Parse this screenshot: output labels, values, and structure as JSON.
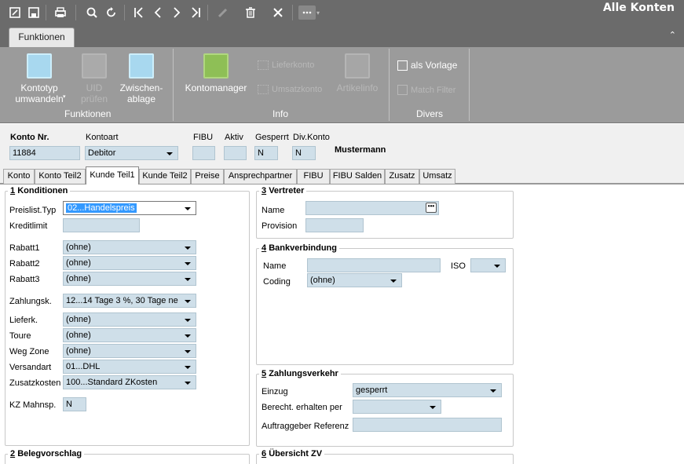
{
  "app": {
    "title": "Alle Konten"
  },
  "toolbar": {
    "icons": [
      "new-icon",
      "save-icon",
      "print-icon",
      "search-icon",
      "refresh-icon",
      "first-icon",
      "prev-icon",
      "next-icon",
      "last-icon",
      "edit-icon",
      "delete-icon",
      "close-icon",
      "more-icon"
    ]
  },
  "ribbon": {
    "tab_label": "Funktionen",
    "groups": {
      "funktionen": {
        "label": "Funktionen",
        "kontotyp": "Kontotyp\numwandeln",
        "uid": "UID\nprüfen",
        "zwischenablage": "Zwischen-\nablage"
      },
      "info": {
        "label": "Info",
        "kontomanager": "Kontomanager",
        "lieferkonto": "Lieferkonto",
        "umsatzkonto": "Umsatzkonto",
        "artikelinfo": "Artikelinfo"
      },
      "divers": {
        "label": "Divers",
        "als_vorlage": "als Vorlage",
        "match_filter": "Match Filter"
      }
    }
  },
  "header": {
    "konto_nr_label": "Konto Nr.",
    "konto_nr": "11884",
    "kontoart_label": "Kontoart",
    "kontoart": "Debitor",
    "fibu_label": "FIBU",
    "fibu": "",
    "aktiv_label": "Aktiv",
    "aktiv": "",
    "gesperrt_label": "Gesperrt",
    "gesperrt": "N",
    "divkonto_label": "Div.Konto",
    "divkonto": "N",
    "name": "Mustermann"
  },
  "tabs": [
    "Konto",
    "Konto Teil2",
    "Kunde Teil1",
    "Kunde Teil2",
    "Preise",
    "Ansprechpartner",
    "FIBU",
    "FIBU Salden",
    "Zusatz",
    "Umsatz"
  ],
  "konditionen": {
    "num": "1",
    "title": "Konditionen",
    "preislist_label": "Preislist.Typ",
    "preislist": "02...Handelspreis",
    "kreditlimit_label": "Kreditlimit",
    "kreditlimit": "",
    "rabatt1_label": "Rabatt1",
    "rabatt1": "(ohne)",
    "rabatt2_label": "Rabatt2",
    "rabatt2": "(ohne)",
    "rabatt3_label": "Rabatt3",
    "rabatt3": "(ohne)",
    "zahlungsk_label": "Zahlungsk.",
    "zahlungsk": "12...14 Tage 3 %, 30 Tage ne",
    "lieferk_label": "Lieferk.",
    "lieferk": "(ohne)",
    "toure_label": "Toure",
    "toure": "(ohne)",
    "wegzone_label": "Weg Zone",
    "wegzone": "(ohne)",
    "versandart_label": "Versandart",
    "versandart": "01...DHL",
    "zusatzkosten_label": "Zusatzkosten",
    "zusatzkosten": "100...Standard ZKosten",
    "kzmahn_label": "KZ Mahnsp.",
    "kzmahn": "N"
  },
  "belegvorschlag": {
    "num": "2",
    "title": "Belegvorschlag"
  },
  "vertreter": {
    "num": "3",
    "title": "Vertreter",
    "name_label": "Name",
    "name": "",
    "provision_label": "Provision",
    "provision": ""
  },
  "bank": {
    "num": "4",
    "title": "Bankverbindung",
    "name_label": "Name",
    "name": "",
    "iso_label": "ISO",
    "iso": "",
    "coding_label": "Coding",
    "coding": "(ohne)"
  },
  "zahlungsverkehr": {
    "num": "5",
    "title": "Zahlungsverkehr",
    "einzug_label": "Einzug",
    "einzug": "gesperrt",
    "berecht_label": "Berecht. erhalten per",
    "berecht": "",
    "auftraggeber_label": "Auftraggeber Referenz",
    "auftraggeber": ""
  },
  "uebersicht": {
    "num": "6",
    "title": "Übersicht ZV"
  }
}
